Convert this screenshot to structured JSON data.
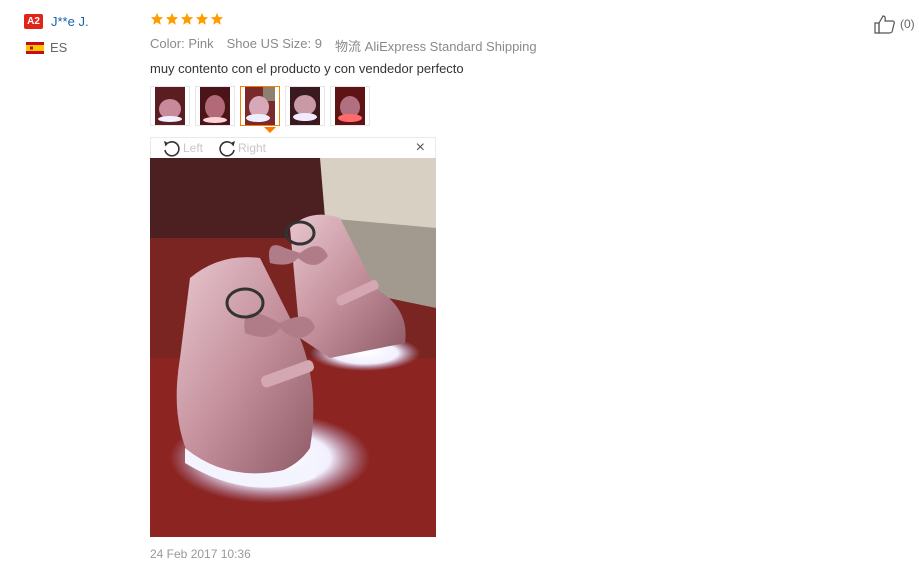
{
  "user": {
    "level_badge": "A2",
    "name": "J**e J.",
    "country_code": "ES",
    "flag_icon": "spain-flag-icon"
  },
  "review": {
    "rating": 5,
    "attributes": [
      {
        "key": "Color:",
        "value": "Pink"
      },
      {
        "key": "Shoe US Size:",
        "value": "9"
      },
      {
        "key": "物流",
        "value": "AliExpress Standard Shipping"
      }
    ],
    "text": "muy contento con el producto y con vendedor perfecto",
    "thumbnail_count": 5,
    "active_thumbnail": 3,
    "viewer": {
      "rotate_left_label": "Left",
      "rotate_right_label": "Right",
      "close_label": "×"
    },
    "date": "24 Feb 2017 10:36"
  },
  "helpful": {
    "count": "(0)",
    "icon": "thumbs-up-icon"
  },
  "colors": {
    "star": "#ff9c00",
    "badge": "#e2231a",
    "username": "#1a5fb4",
    "active_border": "#ff7a00"
  }
}
